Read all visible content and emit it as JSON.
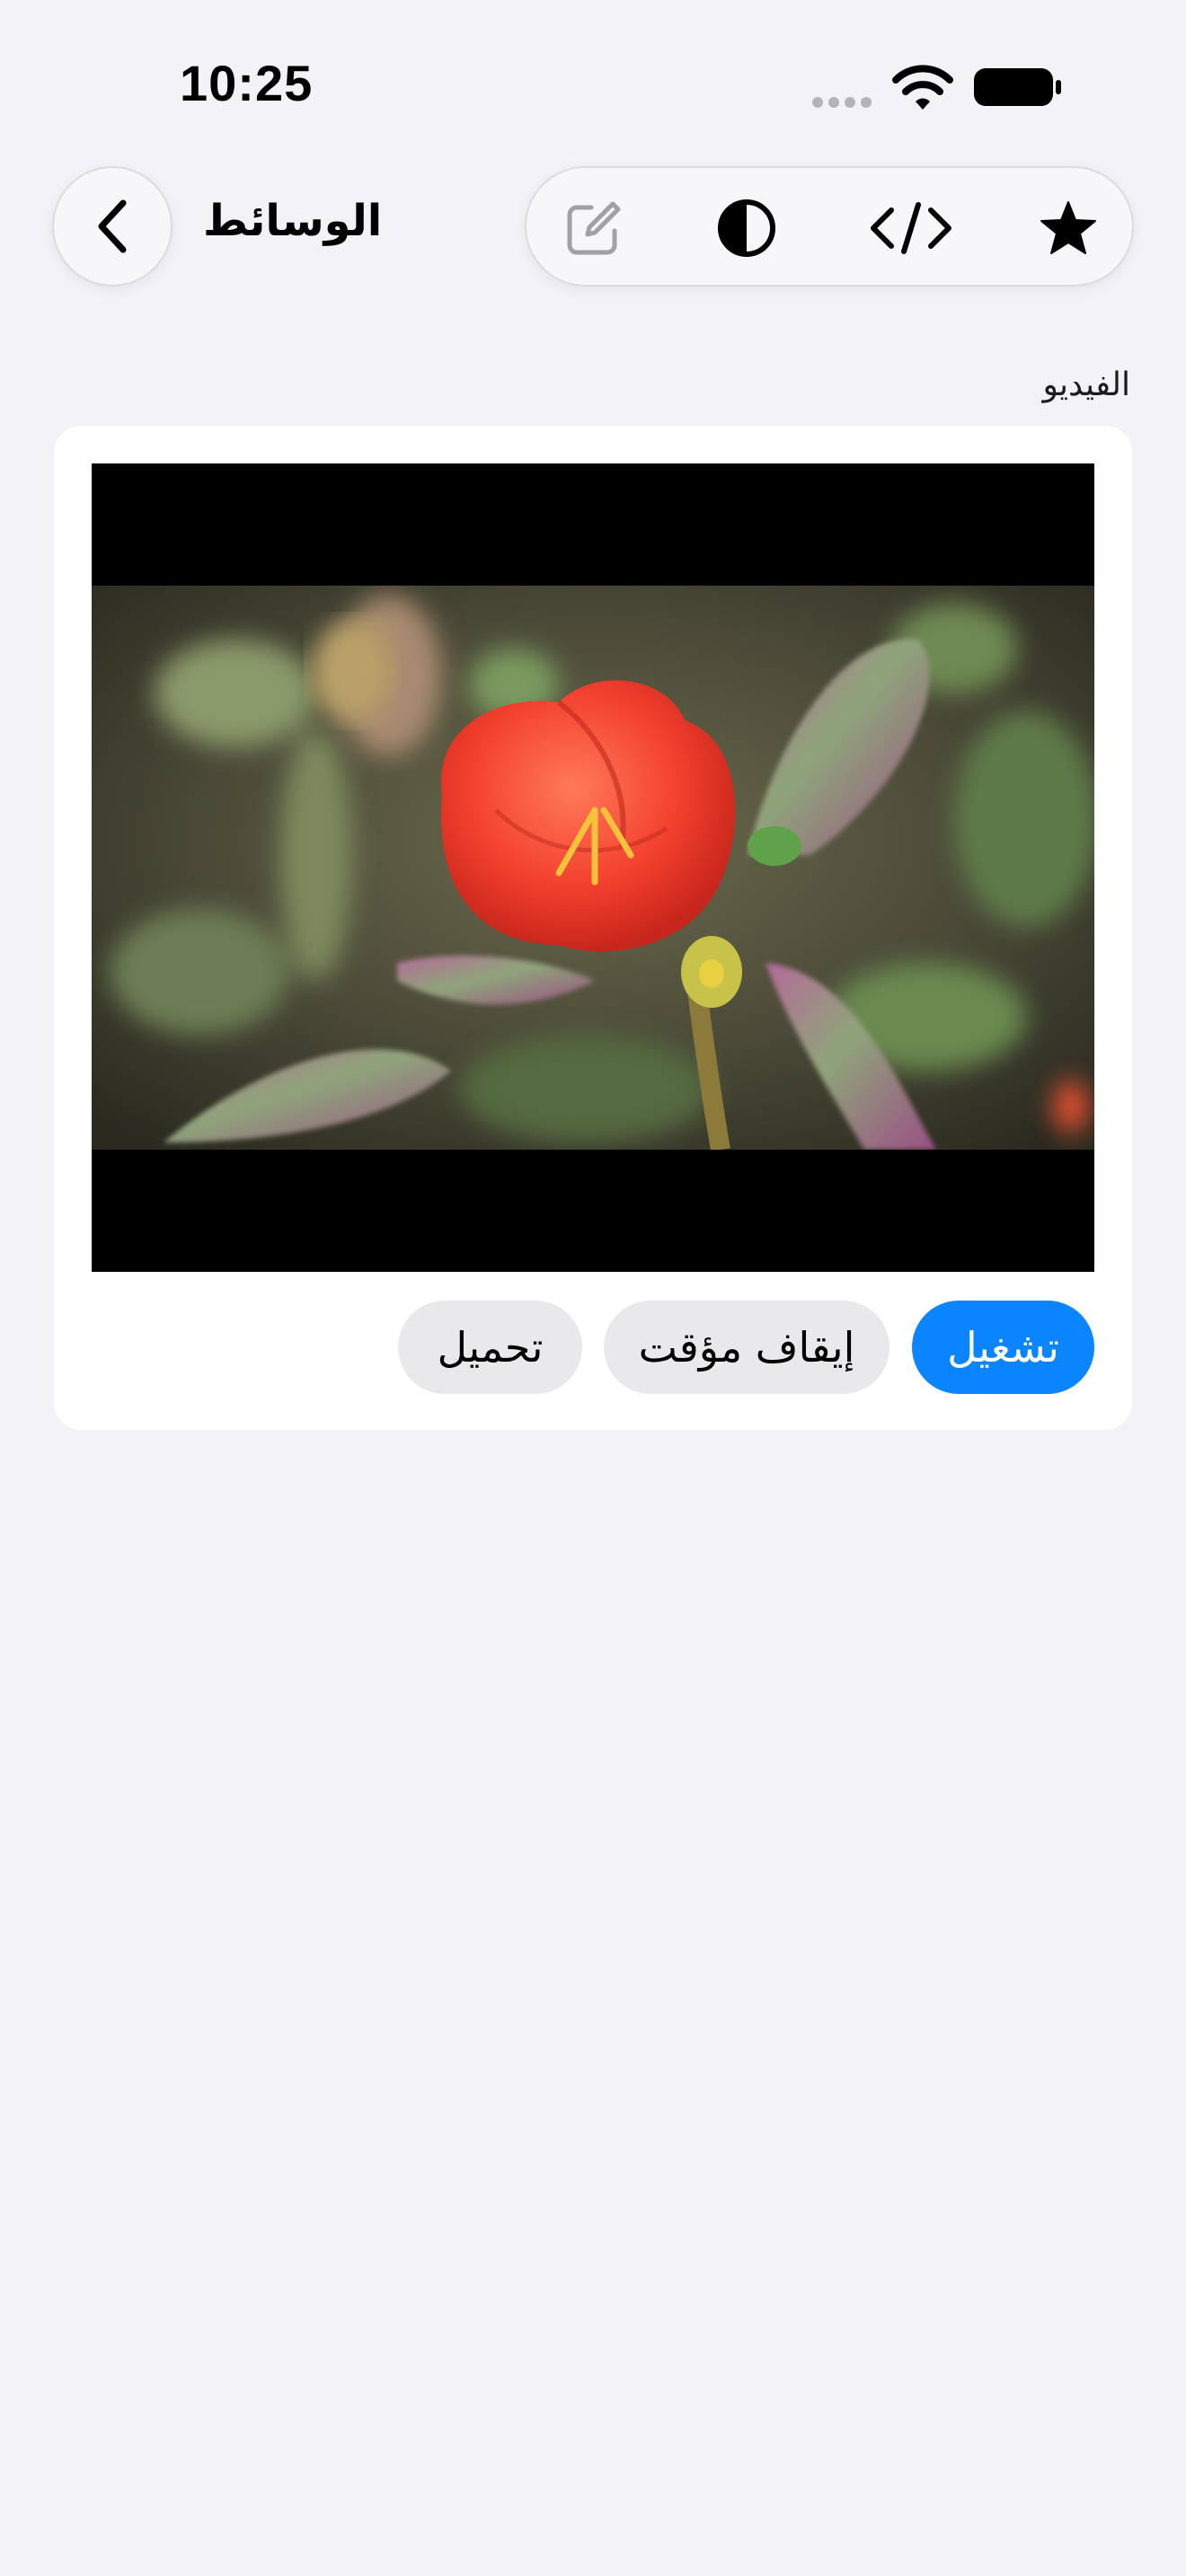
{
  "status_bar": {
    "time": "10:25",
    "icons": [
      "signal-dots-icon",
      "wifi-icon",
      "battery-icon"
    ]
  },
  "nav": {
    "title": "الوسائط",
    "back_icon": "chevron-left-icon",
    "toolbar_icons": [
      "compose-icon",
      "contrast-icon",
      "code-icon",
      "star-icon"
    ]
  },
  "section": {
    "header": "الفيديو"
  },
  "video": {
    "description_icon": "video-player"
  },
  "buttons": {
    "play": "تشغيل",
    "pause": "إيقاف مؤقت",
    "load": "تحميل"
  },
  "colors": {
    "background": "#f2f2f7",
    "card": "#ffffff",
    "accent": "#0a84ff",
    "secondary_button": "#e9e9ec"
  }
}
